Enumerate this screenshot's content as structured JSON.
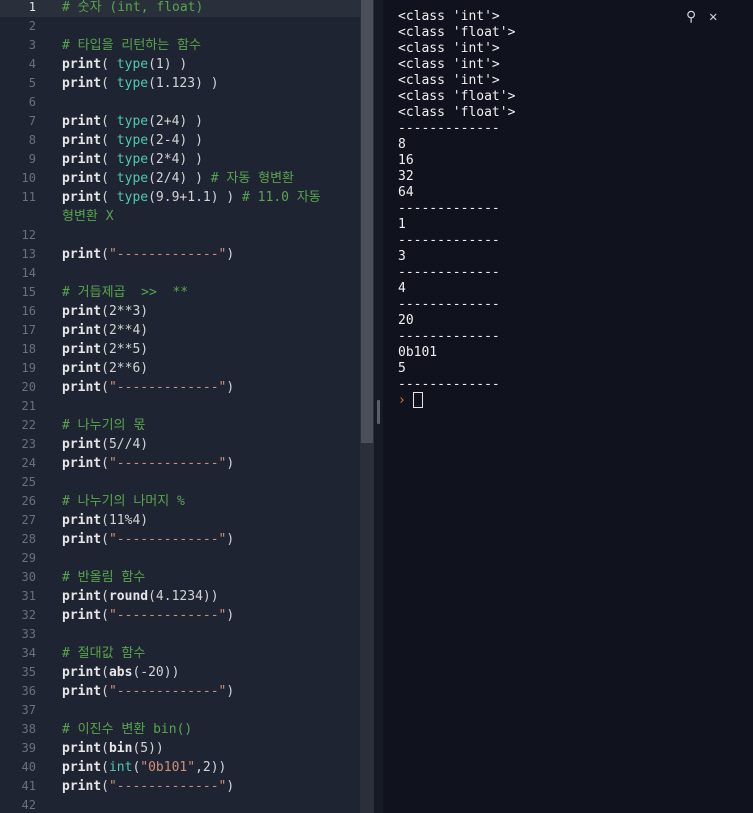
{
  "editor": {
    "active_line": 1,
    "lines": [
      {
        "n": "1",
        "tokens": [
          {
            "t": "# 숫자 (int, float)",
            "c": "cm"
          }
        ]
      },
      {
        "n": "2",
        "tokens": []
      },
      {
        "n": "3",
        "tokens": [
          {
            "t": "# 타입을 리턴하는 함수",
            "c": "cm"
          }
        ]
      },
      {
        "n": "4",
        "tokens": [
          {
            "t": "print",
            "c": "kw"
          },
          {
            "t": "( ",
            "c": ""
          },
          {
            "t": "type",
            "c": "fn"
          },
          {
            "t": "(1) )",
            "c": ""
          }
        ]
      },
      {
        "n": "5",
        "tokens": [
          {
            "t": "print",
            "c": "kw"
          },
          {
            "t": "( ",
            "c": ""
          },
          {
            "t": "type",
            "c": "fn"
          },
          {
            "t": "(1.123) )",
            "c": ""
          }
        ]
      },
      {
        "n": "6",
        "tokens": []
      },
      {
        "n": "7",
        "tokens": [
          {
            "t": "print",
            "c": "kw"
          },
          {
            "t": "( ",
            "c": ""
          },
          {
            "t": "type",
            "c": "fn"
          },
          {
            "t": "(2+4) )",
            "c": ""
          }
        ]
      },
      {
        "n": "8",
        "tokens": [
          {
            "t": "print",
            "c": "kw"
          },
          {
            "t": "( ",
            "c": ""
          },
          {
            "t": "type",
            "c": "fn"
          },
          {
            "t": "(2-4) )",
            "c": ""
          }
        ]
      },
      {
        "n": "9",
        "tokens": [
          {
            "t": "print",
            "c": "kw"
          },
          {
            "t": "( ",
            "c": ""
          },
          {
            "t": "type",
            "c": "fn"
          },
          {
            "t": "(2*4) )",
            "c": ""
          }
        ]
      },
      {
        "n": "10",
        "tokens": [
          {
            "t": "print",
            "c": "kw"
          },
          {
            "t": "( ",
            "c": ""
          },
          {
            "t": "type",
            "c": "fn"
          },
          {
            "t": "(2/4) ) ",
            "c": ""
          },
          {
            "t": "# 자동 형변환",
            "c": "cm"
          }
        ]
      },
      {
        "n": "11",
        "tokens": [
          {
            "t": "print",
            "c": "kw"
          },
          {
            "t": "( ",
            "c": ""
          },
          {
            "t": "type",
            "c": "fn"
          },
          {
            "t": "(9.9+1.1) ) ",
            "c": ""
          },
          {
            "t": "# 11.0 자동",
            "c": "cm"
          }
        ]
      },
      {
        "n": "",
        "tokens": [
          {
            "t": "형변환 X",
            "c": "cm"
          }
        ]
      },
      {
        "n": "12",
        "tokens": []
      },
      {
        "n": "13",
        "tokens": [
          {
            "t": "print",
            "c": "kw"
          },
          {
            "t": "(",
            "c": ""
          },
          {
            "t": "\"-------------\"",
            "c": "str"
          },
          {
            "t": ")",
            "c": ""
          }
        ]
      },
      {
        "n": "14",
        "tokens": []
      },
      {
        "n": "15",
        "tokens": [
          {
            "t": "# 거듭제곱  >>  **",
            "c": "cm"
          }
        ]
      },
      {
        "n": "16",
        "tokens": [
          {
            "t": "print",
            "c": "kw"
          },
          {
            "t": "(2**3)",
            "c": ""
          }
        ]
      },
      {
        "n": "17",
        "tokens": [
          {
            "t": "print",
            "c": "kw"
          },
          {
            "t": "(2**4)",
            "c": ""
          }
        ]
      },
      {
        "n": "18",
        "tokens": [
          {
            "t": "print",
            "c": "kw"
          },
          {
            "t": "(2**5)",
            "c": ""
          }
        ]
      },
      {
        "n": "19",
        "tokens": [
          {
            "t": "print",
            "c": "kw"
          },
          {
            "t": "(2**6)",
            "c": ""
          }
        ]
      },
      {
        "n": "20",
        "tokens": [
          {
            "t": "print",
            "c": "kw"
          },
          {
            "t": "(",
            "c": ""
          },
          {
            "t": "\"-------------\"",
            "c": "str"
          },
          {
            "t": ")",
            "c": ""
          }
        ]
      },
      {
        "n": "21",
        "tokens": []
      },
      {
        "n": "22",
        "tokens": [
          {
            "t": "# 나누기의 몫",
            "c": "cm"
          }
        ]
      },
      {
        "n": "23",
        "tokens": [
          {
            "t": "print",
            "c": "kw"
          },
          {
            "t": "(5//4)",
            "c": ""
          }
        ]
      },
      {
        "n": "24",
        "tokens": [
          {
            "t": "print",
            "c": "kw"
          },
          {
            "t": "(",
            "c": ""
          },
          {
            "t": "\"-------------\"",
            "c": "str"
          },
          {
            "t": ")",
            "c": ""
          }
        ]
      },
      {
        "n": "25",
        "tokens": []
      },
      {
        "n": "26",
        "tokens": [
          {
            "t": "# 나누기의 나머지 %",
            "c": "cm"
          }
        ]
      },
      {
        "n": "27",
        "tokens": [
          {
            "t": "print",
            "c": "kw"
          },
          {
            "t": "(11%4)",
            "c": ""
          }
        ]
      },
      {
        "n": "28",
        "tokens": [
          {
            "t": "print",
            "c": "kw"
          },
          {
            "t": "(",
            "c": ""
          },
          {
            "t": "\"-------------\"",
            "c": "str"
          },
          {
            "t": ")",
            "c": ""
          }
        ]
      },
      {
        "n": "29",
        "tokens": []
      },
      {
        "n": "30",
        "tokens": [
          {
            "t": "# 반올림 함수",
            "c": "cm"
          }
        ]
      },
      {
        "n": "31",
        "tokens": [
          {
            "t": "print",
            "c": "kw"
          },
          {
            "t": "(",
            "c": ""
          },
          {
            "t": "round",
            "c": "kw"
          },
          {
            "t": "(4.1234))",
            "c": ""
          }
        ]
      },
      {
        "n": "32",
        "tokens": [
          {
            "t": "print",
            "c": "kw"
          },
          {
            "t": "(",
            "c": ""
          },
          {
            "t": "\"-------------\"",
            "c": "str"
          },
          {
            "t": ")",
            "c": ""
          }
        ]
      },
      {
        "n": "33",
        "tokens": []
      },
      {
        "n": "34",
        "tokens": [
          {
            "t": "# 절대값 함수",
            "c": "cm"
          }
        ]
      },
      {
        "n": "35",
        "tokens": [
          {
            "t": "print",
            "c": "kw"
          },
          {
            "t": "(",
            "c": ""
          },
          {
            "t": "abs",
            "c": "kw"
          },
          {
            "t": "(-20))",
            "c": ""
          }
        ]
      },
      {
        "n": "36",
        "tokens": [
          {
            "t": "print",
            "c": "kw"
          },
          {
            "t": "(",
            "c": ""
          },
          {
            "t": "\"-------------\"",
            "c": "str"
          },
          {
            "t": ")",
            "c": ""
          }
        ]
      },
      {
        "n": "37",
        "tokens": []
      },
      {
        "n": "38",
        "tokens": [
          {
            "t": "# 이진수 변환 bin()",
            "c": "cm"
          }
        ]
      },
      {
        "n": "39",
        "tokens": [
          {
            "t": "print",
            "c": "kw"
          },
          {
            "t": "(",
            "c": ""
          },
          {
            "t": "bin",
            "c": "kw"
          },
          {
            "t": "(5))",
            "c": ""
          }
        ]
      },
      {
        "n": "40",
        "tokens": [
          {
            "t": "print",
            "c": "kw"
          },
          {
            "t": "(",
            "c": ""
          },
          {
            "t": "int",
            "c": "fn"
          },
          {
            "t": "(",
            "c": ""
          },
          {
            "t": "\"0b101\"",
            "c": "str"
          },
          {
            "t": ",2))",
            "c": ""
          }
        ]
      },
      {
        "n": "41",
        "tokens": [
          {
            "t": "print",
            "c": "kw"
          },
          {
            "t": "(",
            "c": ""
          },
          {
            "t": "\"-------------\"",
            "c": "str"
          },
          {
            "t": ")",
            "c": ""
          }
        ]
      },
      {
        "n": "42",
        "tokens": []
      }
    ]
  },
  "terminal": {
    "output": [
      "<class 'int'>",
      "<class 'float'>",
      "<class 'int'>",
      "<class 'int'>",
      "<class 'int'>",
      "<class 'float'>",
      "<class 'float'>",
      "-------------",
      "8",
      "16",
      "32",
      "64",
      "-------------",
      "1",
      "-------------",
      "3",
      "-------------",
      "4",
      "-------------",
      "20",
      "-------------",
      "0b101",
      "5",
      "-------------"
    ],
    "prompt": "›",
    "tools": [
      {
        "name": "search-icon",
        "glyph": "⚲"
      },
      {
        "name": "close-icon",
        "glyph": "✕"
      }
    ]
  }
}
